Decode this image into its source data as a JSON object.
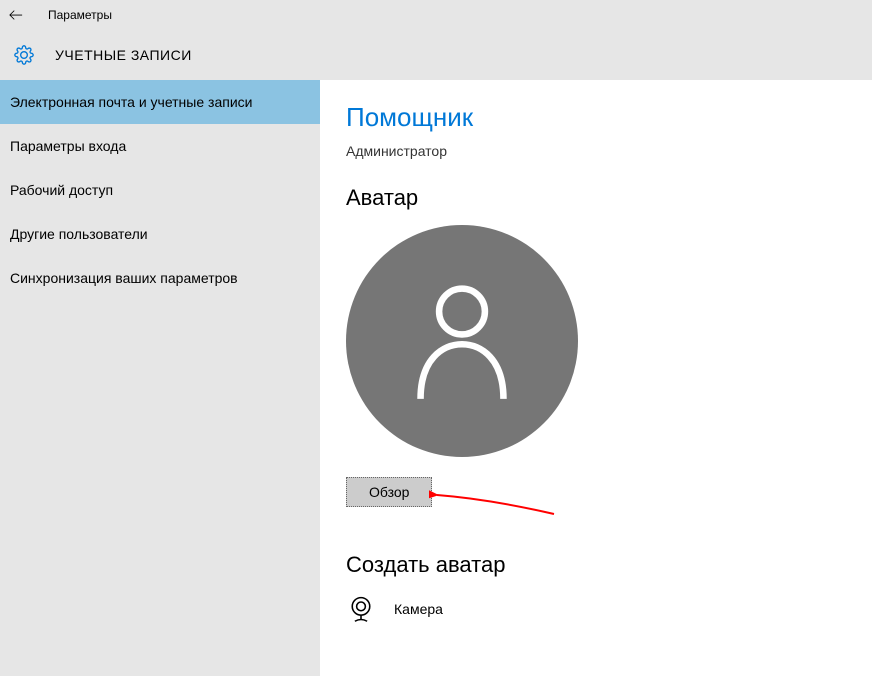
{
  "titlebar": {
    "title": "Параметры"
  },
  "header": {
    "title": "УЧЕТНЫЕ ЗАПИСИ"
  },
  "sidebar": {
    "items": [
      {
        "label": "Электронная почта и учетные записи",
        "active": true
      },
      {
        "label": "Параметры входа",
        "active": false
      },
      {
        "label": "Рабочий доступ",
        "active": false
      },
      {
        "label": "Другие пользователи",
        "active": false
      },
      {
        "label": "Синхронизация ваших параметров",
        "active": false
      }
    ]
  },
  "main": {
    "username": "Помощник",
    "role": "Администратор",
    "avatar_section": "Аватар",
    "browse_label": "Обзор",
    "create_section": "Создать аватар",
    "camera_label": "Камера"
  },
  "colors": {
    "accent": "#0078d7",
    "sidebar_active": "#8bc3e2",
    "panel_bg": "#e6e6e6",
    "avatar_bg": "#767676",
    "annotation": "#ff0000"
  }
}
